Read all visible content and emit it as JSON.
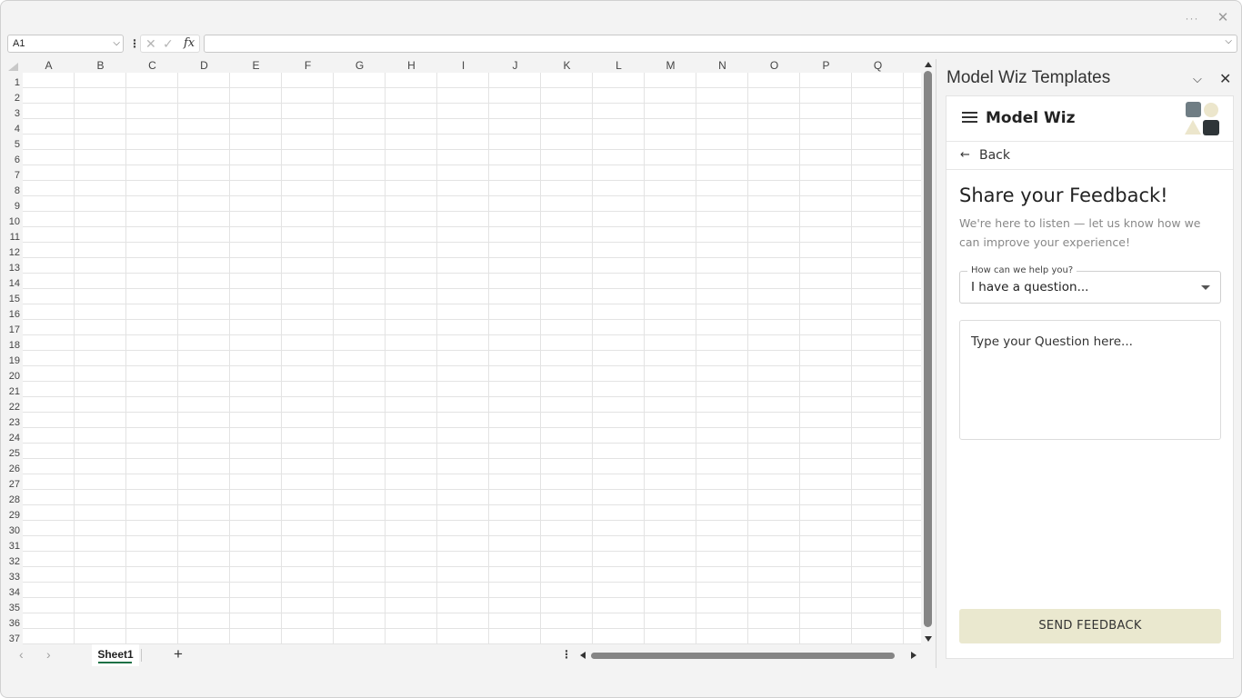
{
  "window": {
    "more_label": "···",
    "close_label": "✕"
  },
  "formula_bar": {
    "name_box": "A1",
    "dropdown_glyph": "⌵",
    "menu_glyph": "⋮",
    "cancel_glyph": "✕",
    "enter_glyph": "✓",
    "fx_label": "fx",
    "formula_value": ""
  },
  "grid": {
    "columns": [
      "A",
      "B",
      "C",
      "D",
      "E",
      "F",
      "G",
      "H",
      "I",
      "J",
      "K",
      "L",
      "M",
      "N",
      "O",
      "P",
      "Q"
    ],
    "rows": [
      "1",
      "2",
      "3",
      "4",
      "5",
      "6",
      "7",
      "8",
      "9",
      "10",
      "11",
      "12",
      "13",
      "14",
      "15",
      "16",
      "17",
      "18",
      "19",
      "20",
      "21",
      "22",
      "23",
      "24",
      "25",
      "26",
      "27",
      "28",
      "29",
      "30",
      "31",
      "32",
      "33",
      "34",
      "35",
      "36",
      "37"
    ]
  },
  "sheets": {
    "prev_glyph": "‹",
    "next_glyph": "›",
    "tabs": [
      "Sheet1"
    ],
    "add_glyph": "+",
    "menu_glyph": "⋮"
  },
  "taskpane": {
    "title": "Model Wiz Templates",
    "collapse_glyph": "⌵",
    "close_glyph": "✕",
    "app_name": "Model Wiz",
    "back_arrow": "←",
    "back_label": "Back",
    "heading": "Share your Feedback!",
    "subtext": "We're here to listen — let us know how we can improve your experience!",
    "select_label": "How can we help you?",
    "select_value": "I have a question...",
    "question_placeholder": "Type your Question here...",
    "send_label": "SEND FEEDBACK",
    "colors": {
      "send_bg": "#eae8cf",
      "logo_dark": "#2e3538",
      "logo_gray": "#6f7d84",
      "logo_cream": "#ece6cc"
    }
  }
}
